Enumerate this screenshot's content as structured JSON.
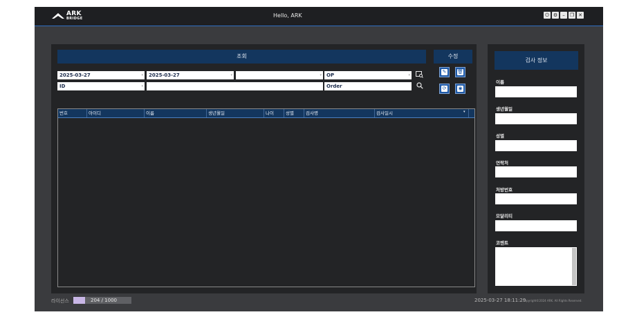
{
  "app": {
    "logo_main": "ARK",
    "logo_sub": "BRIDGE",
    "greeting": "Hello, ARK"
  },
  "window_buttons": [
    "power-icon",
    "settings-icon",
    "minimize-icon",
    "restore-icon",
    "close-icon"
  ],
  "search": {
    "title": "조회",
    "date_from": "2025-03-27",
    "date_to": "2025-03-27",
    "blank_field": "",
    "op_field": "OP",
    "id_field": "ID",
    "keyword_field": "",
    "order_field": "Order"
  },
  "edit": {
    "title": "수정"
  },
  "table": {
    "columns": [
      "번호",
      "아이디",
      "이름",
      "생년월일",
      "나이",
      "성별",
      "검사명",
      "검사일시"
    ],
    "rows": []
  },
  "info": {
    "title": "검사 정보",
    "fields": [
      {
        "label": "이름",
        "value": ""
      },
      {
        "label": "생년월일",
        "value": ""
      },
      {
        "label": "성별",
        "value": ""
      },
      {
        "label": "연락처",
        "value": ""
      },
      {
        "label": "처방번호",
        "value": ""
      },
      {
        "label": "모달리티",
        "value": ""
      }
    ],
    "comment_label": "코멘트",
    "comment_value": ""
  },
  "footer": {
    "license_label": "라이선스",
    "license_text": "204 / 1000",
    "license_used": 204,
    "license_total": 1000,
    "datetime": "2025-03-27 18:11:29",
    "copyright": "Copyright©2024 ARK. All Rights Reserved."
  },
  "colors": {
    "accent": "#13365e",
    "panel": "#232426",
    "background": "#3a3b3e",
    "license_fill": "#c8b6e6"
  }
}
